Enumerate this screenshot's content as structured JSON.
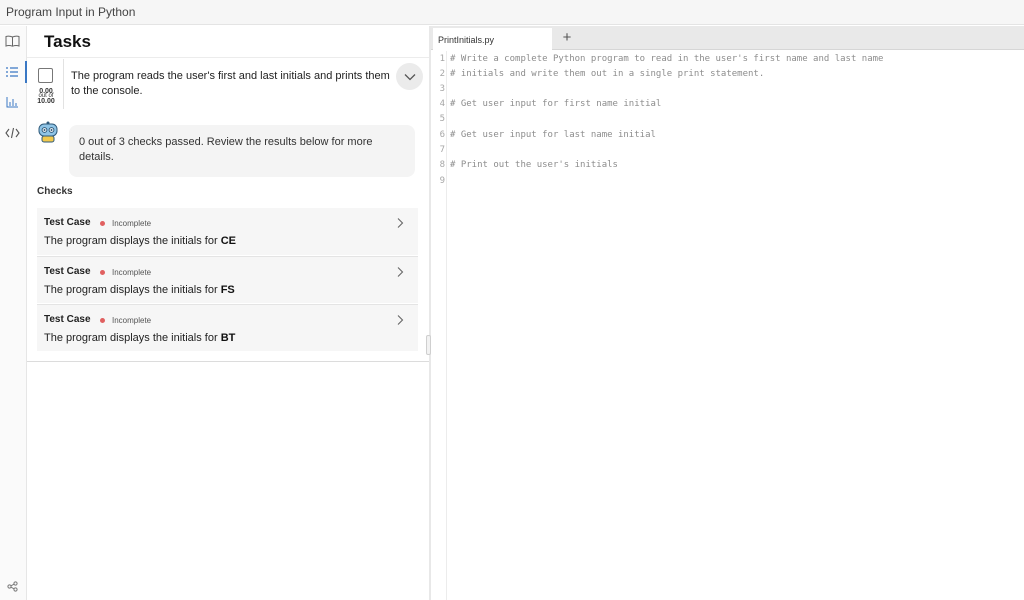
{
  "window": {
    "title": "Program Input in Python"
  },
  "rail": {
    "icons": [
      "book-icon",
      "list-icon",
      "chart-icon",
      "code-icon",
      "share-icon"
    ]
  },
  "tasks": {
    "title": "Tasks",
    "task": {
      "text": "The program reads the user's first and last initials and prints them to the console.",
      "score": {
        "value": "0.00",
        "out_of_label": "out of",
        "max": "10.00"
      }
    },
    "feedback": "0 out of 3 checks passed. Review the results below for more details.",
    "checks_label": "Checks",
    "checks": [
      {
        "name": "Test Case",
        "status": "Incomplete",
        "desc_prefix": "The program displays the initials for ",
        "initials": "CE"
      },
      {
        "name": "Test Case",
        "status": "Incomplete",
        "desc_prefix": "The program displays the initials for ",
        "initials": "FS"
      },
      {
        "name": "Test Case",
        "status": "Incomplete",
        "desc_prefix": "The program displays the initials for ",
        "initials": "BT"
      }
    ]
  },
  "editor": {
    "tab_label": "PrintInitials.py",
    "add_tab_label": "+",
    "lines": [
      {
        "n": "1",
        "text": "# Write a complete Python program to read in the user's first name and last name"
      },
      {
        "n": "2",
        "text": "# initials and write them out in a single print statement."
      },
      {
        "n": "3",
        "text": ""
      },
      {
        "n": "4",
        "text": "# Get user input for first name initial"
      },
      {
        "n": "5",
        "text": ""
      },
      {
        "n": "6",
        "text": "# Get user input for last name initial"
      },
      {
        "n": "7",
        "text": ""
      },
      {
        "n": "8",
        "text": "# Print out the user's initials"
      },
      {
        "n": "9",
        "text": ""
      }
    ]
  },
  "colors": {
    "accent": "#3a78c4",
    "status_incomplete": "#e06060"
  }
}
